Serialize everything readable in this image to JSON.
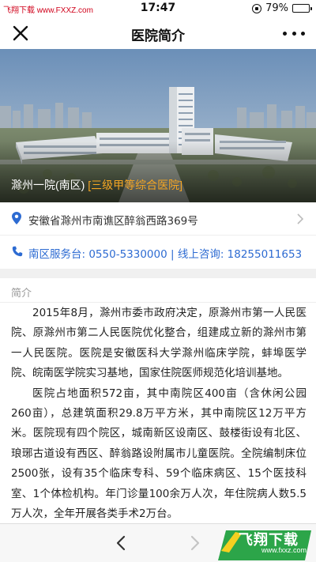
{
  "status_bar": {
    "watermark": "飞翔下载 www.FXXZ.com",
    "time": "17:47",
    "battery": "79%",
    "battery_level": 0.79
  },
  "nav": {
    "title": "医院简介"
  },
  "hero": {
    "hospital_name": "滁州一院(南区)",
    "grade": "[三级甲等综合医院]"
  },
  "address": "安徽省滁州市南谯区醉翁西路369号",
  "contact": "南区服务台: 0550-5330000 | 线上咨询: 18255011653",
  "intro": {
    "label": "简介",
    "paragraphs": [
      "2015年8月，滁州市委市政府决定，原滁州市第一人民医院、原滁州市第二人民医院优化整合，组建成立新的滁州市第一人民医院。医院是安徽医科大学滁州临床学院，蚌埠医学院、皖南医学院实习基地，国家住院医师规范化培训基地。",
      "医院占地面积572亩，其中南院区400亩（含休闲公园260亩），总建筑面积29.8万平方米，其中南院区12万平方米。医院现有四个院区，城南新区设南区、鼓楼街设有北区、琅琊古道设有西区、醉翁路设附属市儿童医院。全院编制床位2500张，设有35个临床专科、59个临床病区、15个医技科室、1个体检机构。年门诊量100余万人次，年住院病人数5.5万人次，全年开展各类手术2万台。"
    ]
  },
  "watermark": {
    "brand": "飞翔下载",
    "url": "www.fxxz.com"
  },
  "colors": {
    "accent_blue": "#2d6bd2",
    "grade_orange": "#f5a623",
    "watermark_red": "#d0021b"
  }
}
